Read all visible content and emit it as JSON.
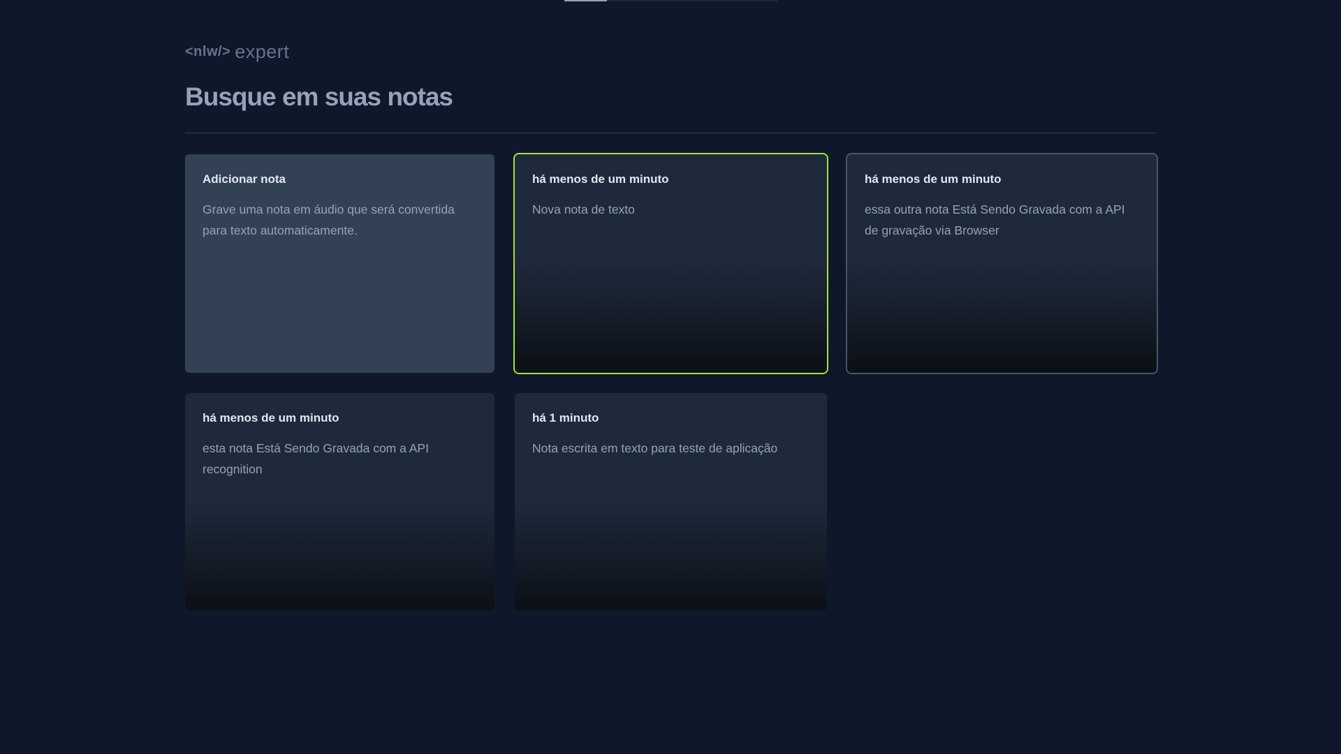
{
  "progress": 0.2,
  "logo": {
    "code": "<nlw/>",
    "word": "expert"
  },
  "page_title": "Busque em suas notas",
  "add_card": {
    "title": "Adicionar nota",
    "text": "Grave uma nota em áudio que será convertida para texto automaticamente."
  },
  "notes": [
    {
      "date": "há menos de um minuto",
      "content": "Nova nota de texto"
    },
    {
      "date": "há menos de um minuto",
      "content": "essa outra nota Está Sendo Gravada com a API de gravação via Browser"
    },
    {
      "date": "há menos de um minuto",
      "content": "esta nota Está Sendo Gravada com a API recognition"
    },
    {
      "date": "há 1 minuto",
      "content": "Nota escrita em texto para teste de aplicação"
    }
  ],
  "colors": {
    "background": "#0f172a",
    "card": "#1e293b",
    "add_card": "#334155",
    "focus_ring": "#a3e635"
  }
}
